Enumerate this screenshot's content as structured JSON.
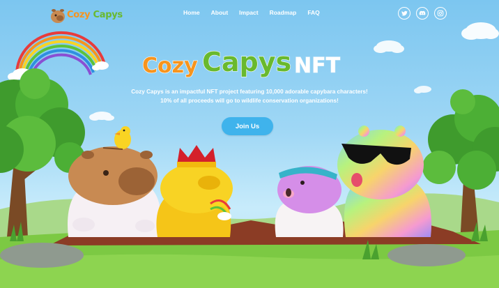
{
  "brand": {
    "name_part1": "Cozy",
    "name_part2": " Capys"
  },
  "nav": {
    "items": [
      {
        "label": "Home"
      },
      {
        "label": "About"
      },
      {
        "label": "Impact"
      },
      {
        "label": "Roadmap"
      },
      {
        "label": "FAQ"
      }
    ],
    "social": [
      {
        "icon": "twitter-icon"
      },
      {
        "icon": "discord-icon"
      },
      {
        "icon": "instagram-icon"
      }
    ]
  },
  "hero": {
    "title_cozy": "Cozy",
    "title_capys": "Capys",
    "title_nft": "NFT",
    "tagline_line1": "Cozy Capys is an impactful NFT project featuring 10,000 adorable capybara characters!",
    "tagline_line2": "10% of all proceeds will go to wildlife conservation organizations!",
    "cta_label": "Join Us"
  },
  "colors": {
    "sky_top": "#7cc6f0",
    "brand_orange": "#f7941d",
    "brand_green": "#69b92e",
    "button_blue": "#3fb3ec",
    "grass": "#7cc943"
  }
}
